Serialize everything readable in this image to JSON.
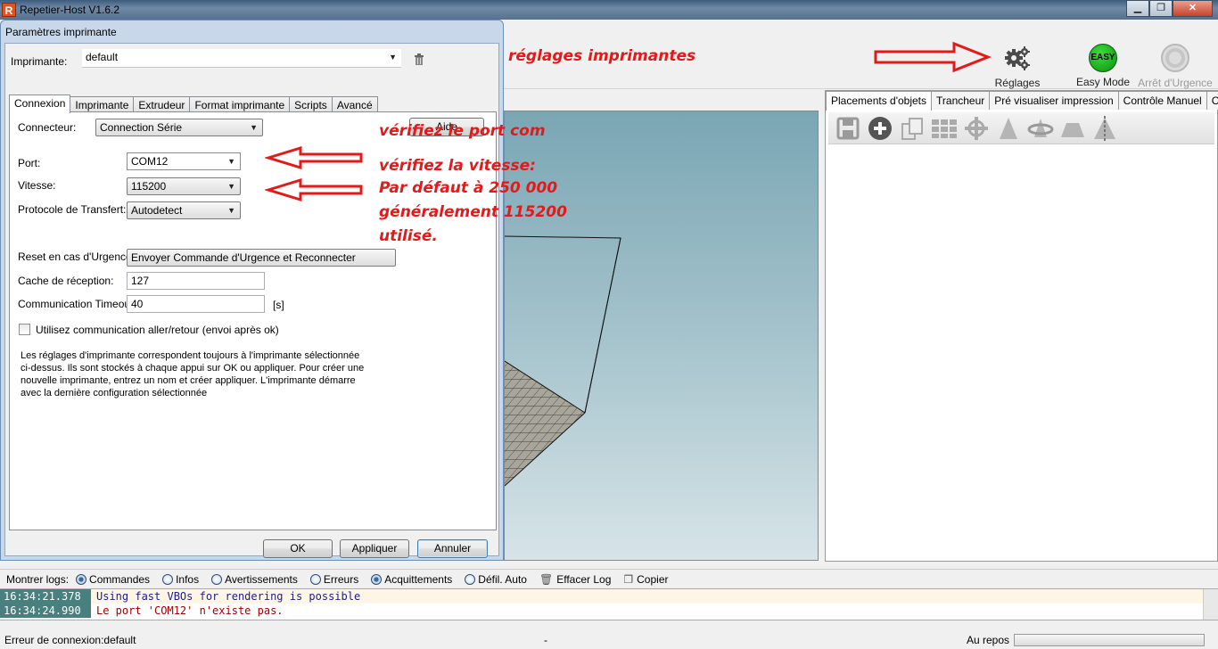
{
  "window": {
    "title": "Repetier-Host V1.6.2",
    "icon": "R",
    "minimize": "▁",
    "maximize": "❐",
    "close": "✕"
  },
  "toolbar": {
    "printer_settings": "Réglages imprimante",
    "easy_mode": "Easy Mode",
    "easy_badge": "EASY",
    "emergency_stop": "Arrêt d'Urgence"
  },
  "annotations": {
    "reglages": "réglages imprimantes",
    "port": "vérifiez le port com",
    "speed_1": "vérifiez la vitesse:",
    "speed_2": "Par défaut à 250 000",
    "speed_3": "généralement 115200",
    "speed_4": "utilisé."
  },
  "right_panel": {
    "tabs": [
      "Placements d'objets",
      "Trancheur",
      "Pré visualiser impression",
      "Contrôle Manuel",
      "Carte SD"
    ],
    "icons": [
      "save-icon",
      "add-icon",
      "copy-icon",
      "grid-icon",
      "center-icon",
      "scale-icon",
      "rotate-icon",
      "cut-icon",
      "mirror-icon"
    ]
  },
  "dialog": {
    "title": "Paramètres imprimante",
    "printer_label": "Imprimante:",
    "printer_value": "default",
    "tabs": [
      "Connexion",
      "Imprimante",
      "Extrudeur",
      "Format imprimante",
      "Scripts",
      "Avancé"
    ],
    "connector_label": "Connecteur:",
    "connector_value": "Connection Série",
    "help_button": "Aide",
    "port_label": "Port:",
    "port_value": "COM12",
    "speed_label": "Vitesse:",
    "speed_value": "115200",
    "protocol_label": "Protocole de Transfert:",
    "protocol_value": "Autodetect",
    "reset_label": "Reset en cas d'Urgence",
    "reset_value": "Envoyer Commande d'Urgence et Reconnecter",
    "cache_label": "Cache de réception:",
    "cache_value": "127",
    "timeout_label": "Communication Timeout:",
    "timeout_value": "40",
    "timeout_unit": "[s]",
    "pingpong_label": "Utilisez communication aller/retour (envoi après ok)",
    "note": [
      "Les réglages d'imprimante correspondent toujours à l'imprimante sélectionnée",
      "ci-dessus. Ils sont stockés à chaque appui sur OK ou appliquer. Pour créer une",
      "nouvelle imprimante, entrez un nom et créer appliquer. L'imprimante démarre",
      "avec la dernière configuration sélectionnée"
    ],
    "ok_button": "OK",
    "apply_button": "Appliquer",
    "cancel_button": "Annuler"
  },
  "logs": {
    "show_label": "Montrer logs:",
    "filters": [
      {
        "label": "Commandes",
        "on": true
      },
      {
        "label": "Infos",
        "on": false
      },
      {
        "label": "Avertissements",
        "on": false
      },
      {
        "label": "Erreurs",
        "on": false
      },
      {
        "label": "Acquittements",
        "on": true
      },
      {
        "label": "Défil. Auto",
        "on": false
      }
    ],
    "clear_label": "Effacer Log",
    "copy_label": "Copier",
    "lines": [
      {
        "time": "16:34:21.378",
        "message": "Using fast VBOs for rendering is possible",
        "kind": "info"
      },
      {
        "time": "16:34:24.990",
        "message": "Le port 'COM12' n'existe pas.",
        "kind": "err"
      }
    ]
  },
  "status": {
    "left": "Erreur de connexion:default",
    "middle": "-",
    "right": "Au repos"
  }
}
